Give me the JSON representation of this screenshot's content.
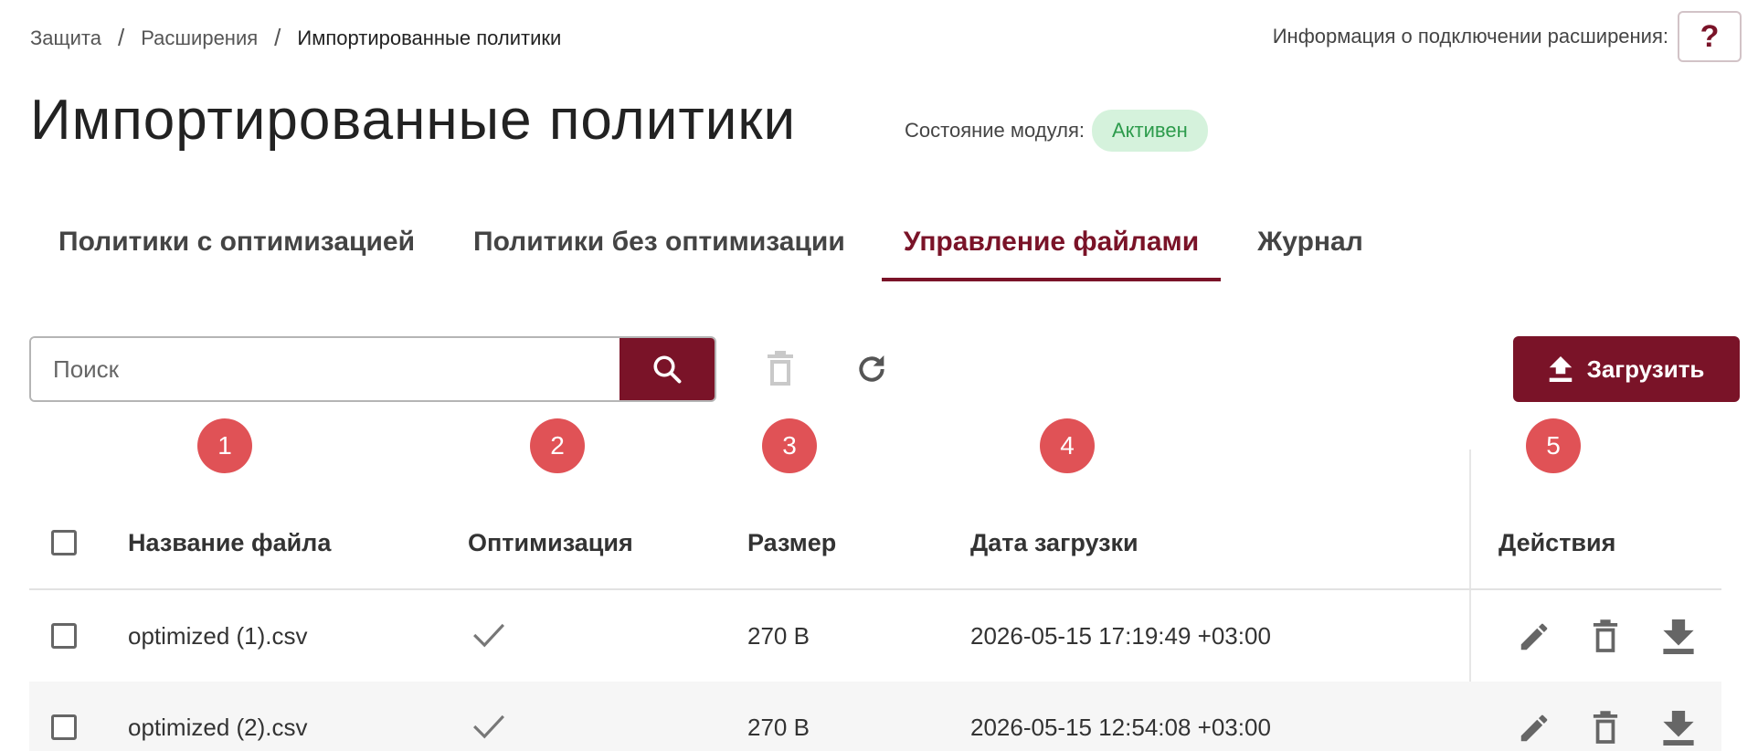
{
  "breadcrumb": {
    "items": [
      "Защита",
      "Расширения",
      "Импортированные политики"
    ],
    "separator": "/"
  },
  "connection_info": {
    "label": "Информация о подключении расширения:",
    "help_label": "?"
  },
  "page": {
    "title": "Импортированные политики",
    "module_state_label": "Состояние модуля:",
    "module_state_value": "Активен"
  },
  "tabs": [
    {
      "label": "Политики с оптимизацией",
      "active": false
    },
    {
      "label": "Политики без оптимизации",
      "active": false
    },
    {
      "label": "Управление файлами",
      "active": true
    },
    {
      "label": "Журнал",
      "active": false
    }
  ],
  "toolbar": {
    "search_placeholder": "Поиск",
    "upload_label": "Загрузить"
  },
  "markers": [
    "1",
    "2",
    "3",
    "4",
    "5"
  ],
  "table": {
    "columns": [
      "Название файла",
      "Оптимизация",
      "Размер",
      "Дата загрузки",
      "Действия"
    ],
    "rows": [
      {
        "name": "optimized (1).csv",
        "optimized": true,
        "size": "270 B",
        "date": "2026-05-15 17:19:49 +03:00"
      },
      {
        "name": "optimized (2).csv",
        "optimized": true,
        "size": "270 B",
        "date": "2026-05-15 12:54:08 +03:00"
      }
    ]
  },
  "icons": {
    "search": "search-icon",
    "delete": "trash-icon",
    "refresh": "refresh-icon",
    "upload": "upload-icon",
    "edit": "pencil-icon",
    "download": "download-icon",
    "check": "check-icon"
  },
  "colors": {
    "brand": "#7a1328",
    "badge_bg": "#d5f2dc",
    "badge_text": "#2d9b4c",
    "marker": "#e05256"
  }
}
